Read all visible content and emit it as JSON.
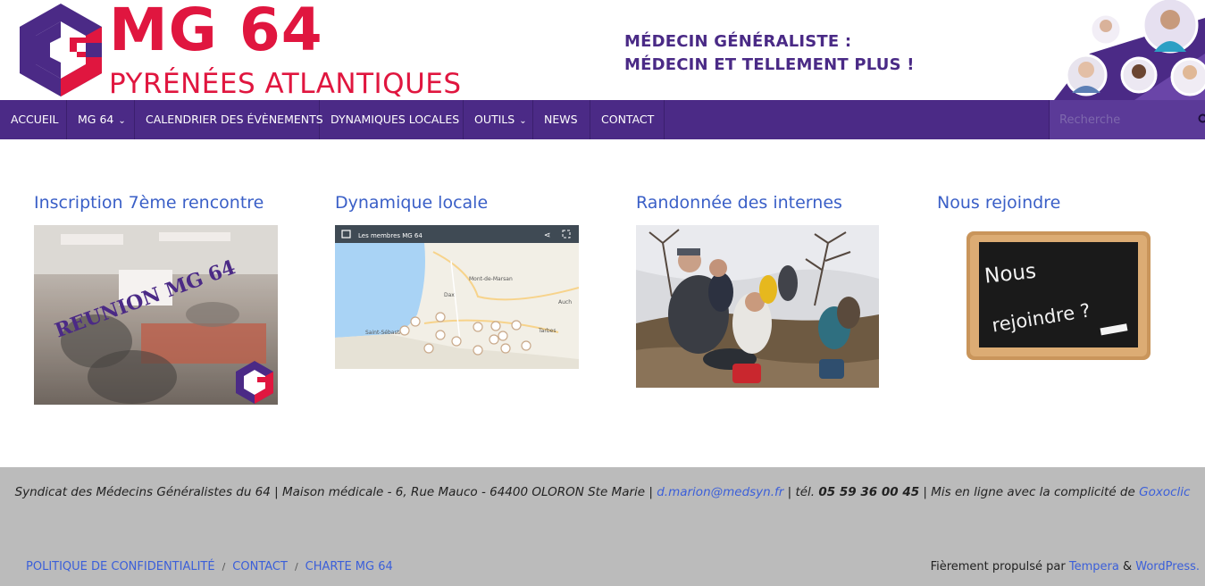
{
  "header": {
    "logo_main": "MG 64",
    "logo_sub": "PYRÉNÉES ATLANTIQUES",
    "tagline_line1": "MÉDECIN GÉNÉRALISTE :",
    "tagline_line2": "MÉDECIN ET TELLEMENT PLUS !"
  },
  "nav": {
    "items": [
      {
        "label": "ACCUEIL"
      },
      {
        "label": "MG 64"
      },
      {
        "label": "CALENDRIER DES ÉVÈNEMENTS"
      },
      {
        "label": "DYNAMIQUES LOCALES"
      },
      {
        "label": "OUTILS"
      },
      {
        "label": "NEWS"
      },
      {
        "label": "CONTACT"
      }
    ],
    "search_placeholder": "Recherche"
  },
  "widgets": [
    {
      "title": "Inscription 7ème rencontre",
      "image_text": "REUNION MG 64"
    },
    {
      "title": "Dynamique locale",
      "image_text": "Les membres MG 64"
    },
    {
      "title": "Randonnée des internes"
    },
    {
      "title": "Nous rejoindre",
      "image_text_1": "Nous",
      "image_text_2": "rejoindre ?"
    }
  ],
  "map_labels": {
    "mont": "Mont-de-Marsan",
    "dax": "Dax",
    "auch": "Auch",
    "tarbes": "Tarbes",
    "seb": "Saint-Sébastien"
  },
  "footer": {
    "line_a": "Syndicat des Médecins Généralistes du 64 | Maison médicale - 6, Rue Mauco - 64400 OLORON Ste Marie | ",
    "email": "d.marion@medsyn.fr",
    "line_b": " | tél. ",
    "phone": "05 59 36 00 45",
    "line_c": " | Mis en ligne avec la complicité de ",
    "agency": "Goxoclic",
    "links": [
      "POLITIQUE DE CONFIDENTIALITÉ",
      "CONTACT",
      "CHARTE MG 64"
    ],
    "credit_prefix": "Fièrement propulsé par ",
    "credit_theme": "Tempera",
    "credit_amp": " & ",
    "credit_wp": "WordPress."
  },
  "colors": {
    "brand_red": "#e0163f",
    "brand_purple": "#4b2a86",
    "link_blue": "#3a5fc7"
  }
}
